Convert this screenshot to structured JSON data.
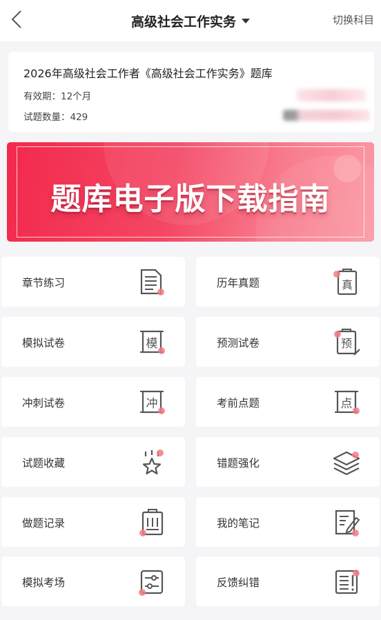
{
  "header": {
    "back_icon": "chevron-left-icon",
    "title": "高级社会工作实务",
    "switch_label": "切换科目"
  },
  "info": {
    "name": "2026年高级社会工作者《高级社会工作实务》题库",
    "validity": "有效期：12个月",
    "count": "试题数量：429"
  },
  "banner": {
    "headline": "题库电子版下载指南"
  },
  "accent_color": "#f47a84",
  "tiles": [
    {
      "label": "章节练习",
      "icon": "document-lines-icon"
    },
    {
      "label": "历年真题",
      "icon": "clipboard-zhen-icon"
    },
    {
      "label": "模拟试卷",
      "icon": "scroll-mo-icon"
    },
    {
      "label": "预测试卷",
      "icon": "clipboard-yu-icon"
    },
    {
      "label": "冲刺试卷",
      "icon": "scroll-chong-icon"
    },
    {
      "label": "考前点题",
      "icon": "scroll-dian-icon"
    },
    {
      "label": "试题收藏",
      "icon": "star-icon"
    },
    {
      "label": "错题强化",
      "icon": "layers-icon"
    },
    {
      "label": "做题记录",
      "icon": "clipboard-list-icon"
    },
    {
      "label": "我的笔记",
      "icon": "note-pen-icon"
    },
    {
      "label": "模拟考场",
      "icon": "sliders-panel-icon"
    },
    {
      "label": "反馈纠错",
      "icon": "feedback-doc-icon"
    }
  ]
}
